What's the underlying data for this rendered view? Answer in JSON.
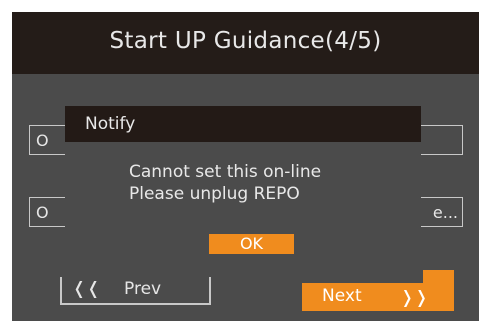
{
  "header": {
    "title": "Start UP Guidance(4/5)"
  },
  "options": [
    {
      "label": "O",
      "right_text": ""
    },
    {
      "label": "O",
      "right_text": "e..."
    }
  ],
  "dialog": {
    "title": "Notify",
    "message_line1": "Cannot set this on-line",
    "message_line2": "Please unplug REPO",
    "ok_label": "OK"
  },
  "nav": {
    "prev_arrow": "❬❬",
    "prev_label": "Prev",
    "next_label": "Next",
    "next_arrow": "❭❭"
  },
  "colors": {
    "accent": "#f08c1e",
    "background": "#4b4b4b",
    "header_bg": "#241c18"
  }
}
